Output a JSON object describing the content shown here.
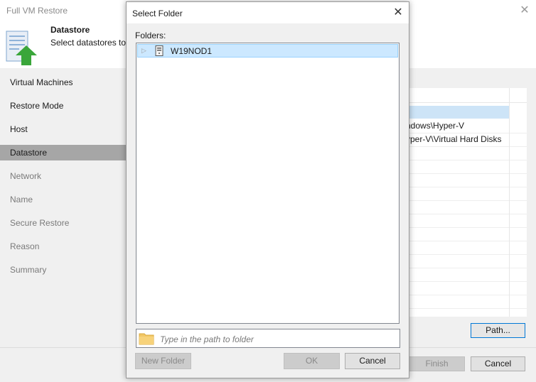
{
  "window": {
    "title": "Full VM Restore"
  },
  "header": {
    "title": "Datastore",
    "description": "Select datastores to"
  },
  "sidebar": {
    "items": [
      {
        "label": "Virtual Machines",
        "state": "done"
      },
      {
        "label": "Restore Mode",
        "state": "done"
      },
      {
        "label": "Host",
        "state": "done"
      },
      {
        "label": "Datastore",
        "state": "active"
      },
      {
        "label": "Network",
        "state": "pending"
      },
      {
        "label": "Name",
        "state": "pending"
      },
      {
        "label": "Secure Restore",
        "state": "pending"
      },
      {
        "label": "Reason",
        "state": "pending"
      },
      {
        "label": "Summary",
        "state": "pending"
      }
    ]
  },
  "grid": {
    "rows": [
      "",
      "ndows\\Hyper-V",
      "yper-V\\Virtual Hard Disks"
    ]
  },
  "buttons": {
    "path": "Path...",
    "finish": "Finish",
    "cancel": "Cancel"
  },
  "dialog": {
    "title": "Select Folder",
    "folders_label": "Folders:",
    "tree": [
      {
        "label": "W19NOD1",
        "icon": "server-icon",
        "selected": true,
        "expandable": true
      }
    ],
    "path_placeholder": "Type in the path to folder",
    "new_folder_label": "New Folder",
    "ok_label": "OK",
    "cancel_label": "Cancel"
  },
  "colors": {
    "selection": "#cce8ff",
    "active_step": "#a6a6a6",
    "focus_border": "#0078d7",
    "arrow_green": "#3aa63a"
  }
}
